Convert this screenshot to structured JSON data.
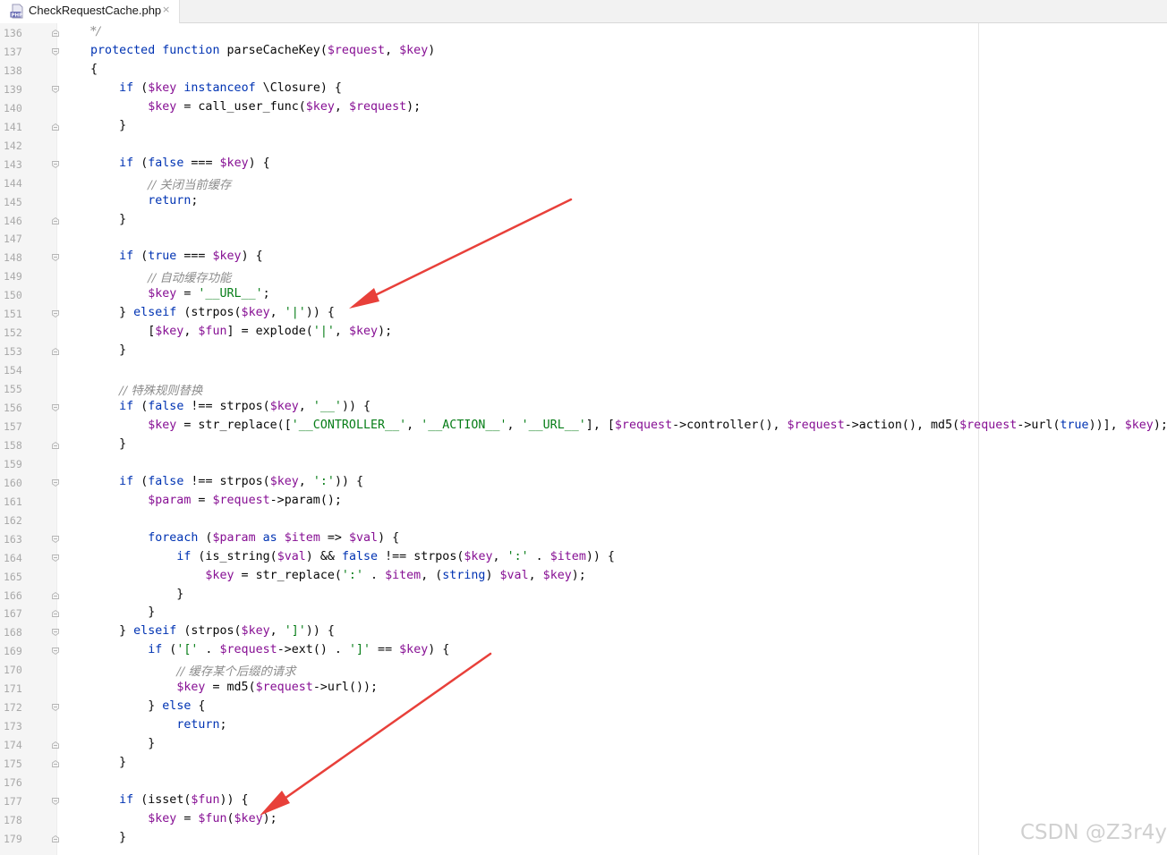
{
  "tab": {
    "file_icon": "php-file-icon",
    "title": "CheckRequestCache.php",
    "close_glyph": "×"
  },
  "editor": {
    "lines": [
      {
        "n": "136",
        "fold": "end",
        "tokens": [
          [
            "cm",
            "*/"
          ]
        ]
      },
      {
        "n": "137",
        "fold": "start",
        "tokens": [
          [
            "kw",
            "protected"
          ],
          [
            "t",
            " "
          ],
          [
            "kw",
            "function"
          ],
          [
            "t",
            " parseCacheKey("
          ],
          [
            "var",
            "$request"
          ],
          [
            "t",
            ", "
          ],
          [
            "var",
            "$key"
          ],
          [
            "t",
            ")"
          ]
        ]
      },
      {
        "n": "138",
        "fold": "",
        "tokens": [
          [
            "t",
            "{"
          ]
        ]
      },
      {
        "n": "139",
        "fold": "start",
        "tokens": [
          [
            "t",
            "    "
          ],
          [
            "kw",
            "if"
          ],
          [
            "t",
            " ("
          ],
          [
            "var",
            "$key"
          ],
          [
            "t",
            " "
          ],
          [
            "kw",
            "instanceof"
          ],
          [
            "t",
            " \\Closure) {"
          ]
        ]
      },
      {
        "n": "140",
        "fold": "",
        "tokens": [
          [
            "t",
            "        "
          ],
          [
            "var",
            "$key"
          ],
          [
            "t",
            " = call_user_func("
          ],
          [
            "var",
            "$key"
          ],
          [
            "t",
            ", "
          ],
          [
            "var",
            "$request"
          ],
          [
            "t",
            ");"
          ]
        ]
      },
      {
        "n": "141",
        "fold": "end",
        "tokens": [
          [
            "t",
            "    }"
          ]
        ]
      },
      {
        "n": "142",
        "fold": "",
        "tokens": []
      },
      {
        "n": "143",
        "fold": "start",
        "tokens": [
          [
            "t",
            "    "
          ],
          [
            "kw",
            "if"
          ],
          [
            "t",
            " ("
          ],
          [
            "kw",
            "false"
          ],
          [
            "t",
            " === "
          ],
          [
            "var",
            "$key"
          ],
          [
            "t",
            ") {"
          ]
        ]
      },
      {
        "n": "144",
        "fold": "",
        "tokens": [
          [
            "t",
            "        "
          ],
          [
            "cm",
            "// 关闭当前缓存"
          ]
        ]
      },
      {
        "n": "145",
        "fold": "",
        "tokens": [
          [
            "t",
            "        "
          ],
          [
            "kw",
            "return"
          ],
          [
            "t",
            ";"
          ]
        ]
      },
      {
        "n": "146",
        "fold": "end",
        "tokens": [
          [
            "t",
            "    }"
          ]
        ]
      },
      {
        "n": "147",
        "fold": "",
        "tokens": []
      },
      {
        "n": "148",
        "fold": "start",
        "tokens": [
          [
            "t",
            "    "
          ],
          [
            "kw",
            "if"
          ],
          [
            "t",
            " ("
          ],
          [
            "kw",
            "true"
          ],
          [
            "t",
            " === "
          ],
          [
            "var",
            "$key"
          ],
          [
            "t",
            ") {"
          ]
        ]
      },
      {
        "n": "149",
        "fold": "",
        "tokens": [
          [
            "t",
            "        "
          ],
          [
            "cm",
            "// 自动缓存功能"
          ]
        ]
      },
      {
        "n": "150",
        "fold": "",
        "tokens": [
          [
            "t",
            "        "
          ],
          [
            "var",
            "$key"
          ],
          [
            "t",
            " = "
          ],
          [
            "str",
            "'__URL__'"
          ],
          [
            "t",
            ";"
          ]
        ]
      },
      {
        "n": "151",
        "fold": "start",
        "tokens": [
          [
            "t",
            "    } "
          ],
          [
            "kw",
            "elseif"
          ],
          [
            "t",
            " (strpos("
          ],
          [
            "var",
            "$key"
          ],
          [
            "t",
            ", "
          ],
          [
            "str",
            "'|'"
          ],
          [
            "t",
            ")) {"
          ]
        ]
      },
      {
        "n": "152",
        "fold": "",
        "tokens": [
          [
            "t",
            "        ["
          ],
          [
            "var",
            "$key"
          ],
          [
            "t",
            ", "
          ],
          [
            "var",
            "$fun"
          ],
          [
            "t",
            "] = explode("
          ],
          [
            "str",
            "'|'"
          ],
          [
            "t",
            ", "
          ],
          [
            "var",
            "$key"
          ],
          [
            "t",
            ");"
          ]
        ]
      },
      {
        "n": "153",
        "fold": "end",
        "tokens": [
          [
            "t",
            "    }"
          ]
        ]
      },
      {
        "n": "154",
        "fold": "",
        "tokens": []
      },
      {
        "n": "155",
        "fold": "",
        "tokens": [
          [
            "t",
            "    "
          ],
          [
            "cm",
            "// 特殊规则替换"
          ]
        ]
      },
      {
        "n": "156",
        "fold": "start",
        "tokens": [
          [
            "t",
            "    "
          ],
          [
            "kw",
            "if"
          ],
          [
            "t",
            " ("
          ],
          [
            "kw",
            "false"
          ],
          [
            "t",
            " !== strpos("
          ],
          [
            "var",
            "$key"
          ],
          [
            "t",
            ", "
          ],
          [
            "str",
            "'__'"
          ],
          [
            "t",
            ")) {"
          ]
        ]
      },
      {
        "n": "157",
        "fold": "",
        "tokens": [
          [
            "t",
            "        "
          ],
          [
            "var",
            "$key"
          ],
          [
            "t",
            " = str_replace(["
          ],
          [
            "str",
            "'__CONTROLLER__'"
          ],
          [
            "t",
            ", "
          ],
          [
            "str",
            "'__ACTION__'"
          ],
          [
            "t",
            ", "
          ],
          [
            "str",
            "'__URL__'"
          ],
          [
            "t",
            "], ["
          ],
          [
            "var",
            "$request"
          ],
          [
            "t",
            "->controller(), "
          ],
          [
            "var",
            "$request"
          ],
          [
            "t",
            "->action(), md5("
          ],
          [
            "var",
            "$request"
          ],
          [
            "t",
            "->url("
          ],
          [
            "kw",
            "true"
          ],
          [
            "t",
            "))], "
          ],
          [
            "var",
            "$key"
          ],
          [
            "t",
            ");"
          ]
        ]
      },
      {
        "n": "158",
        "fold": "end",
        "tokens": [
          [
            "t",
            "    }"
          ]
        ]
      },
      {
        "n": "159",
        "fold": "",
        "tokens": []
      },
      {
        "n": "160",
        "fold": "start",
        "tokens": [
          [
            "t",
            "    "
          ],
          [
            "kw",
            "if"
          ],
          [
            "t",
            " ("
          ],
          [
            "kw",
            "false"
          ],
          [
            "t",
            " !== strpos("
          ],
          [
            "var",
            "$key"
          ],
          [
            "t",
            ", "
          ],
          [
            "str",
            "':'"
          ],
          [
            "t",
            ")) {"
          ]
        ]
      },
      {
        "n": "161",
        "fold": "",
        "tokens": [
          [
            "t",
            "        "
          ],
          [
            "var",
            "$param"
          ],
          [
            "t",
            " = "
          ],
          [
            "var",
            "$request"
          ],
          [
            "t",
            "->param();"
          ]
        ]
      },
      {
        "n": "162",
        "fold": "",
        "tokens": []
      },
      {
        "n": "163",
        "fold": "start",
        "tokens": [
          [
            "t",
            "        "
          ],
          [
            "kw",
            "foreach"
          ],
          [
            "t",
            " ("
          ],
          [
            "var",
            "$param"
          ],
          [
            "t",
            " "
          ],
          [
            "kw",
            "as"
          ],
          [
            "t",
            " "
          ],
          [
            "var",
            "$item"
          ],
          [
            "t",
            " => "
          ],
          [
            "var",
            "$val"
          ],
          [
            "t",
            ") {"
          ]
        ]
      },
      {
        "n": "164",
        "fold": "start",
        "tokens": [
          [
            "t",
            "            "
          ],
          [
            "kw",
            "if"
          ],
          [
            "t",
            " (is_string("
          ],
          [
            "var",
            "$val"
          ],
          [
            "t",
            ") && "
          ],
          [
            "kw",
            "false"
          ],
          [
            "t",
            " !== strpos("
          ],
          [
            "var",
            "$key"
          ],
          [
            "t",
            ", "
          ],
          [
            "str",
            "':'"
          ],
          [
            "t",
            " . "
          ],
          [
            "var",
            "$item"
          ],
          [
            "t",
            ")) {"
          ]
        ]
      },
      {
        "n": "165",
        "fold": "",
        "tokens": [
          [
            "t",
            "                "
          ],
          [
            "var",
            "$key"
          ],
          [
            "t",
            " = str_replace("
          ],
          [
            "str",
            "':'"
          ],
          [
            "t",
            " . "
          ],
          [
            "var",
            "$item"
          ],
          [
            "t",
            ", ("
          ],
          [
            "kw",
            "string"
          ],
          [
            "t",
            ") "
          ],
          [
            "var",
            "$val"
          ],
          [
            "t",
            ", "
          ],
          [
            "var",
            "$key"
          ],
          [
            "t",
            ");"
          ]
        ]
      },
      {
        "n": "166",
        "fold": "end",
        "tokens": [
          [
            "t",
            "            }"
          ]
        ]
      },
      {
        "n": "167",
        "fold": "end",
        "tokens": [
          [
            "t",
            "        }"
          ]
        ]
      },
      {
        "n": "168",
        "fold": "start",
        "tokens": [
          [
            "t",
            "    } "
          ],
          [
            "kw",
            "elseif"
          ],
          [
            "t",
            " (strpos("
          ],
          [
            "var",
            "$key"
          ],
          [
            "t",
            ", "
          ],
          [
            "str",
            "']'"
          ],
          [
            "t",
            ")) {"
          ]
        ]
      },
      {
        "n": "169",
        "fold": "start",
        "tokens": [
          [
            "t",
            "        "
          ],
          [
            "kw",
            "if"
          ],
          [
            "t",
            " ("
          ],
          [
            "str",
            "'['"
          ],
          [
            "t",
            " . "
          ],
          [
            "var",
            "$request"
          ],
          [
            "t",
            "->ext() . "
          ],
          [
            "str",
            "']'"
          ],
          [
            "t",
            " == "
          ],
          [
            "var",
            "$key"
          ],
          [
            "t",
            ") {"
          ]
        ]
      },
      {
        "n": "170",
        "fold": "",
        "tokens": [
          [
            "t",
            "            "
          ],
          [
            "cm",
            "// 缓存某个后缀的请求"
          ]
        ]
      },
      {
        "n": "171",
        "fold": "",
        "tokens": [
          [
            "t",
            "            "
          ],
          [
            "var",
            "$key"
          ],
          [
            "t",
            " = md5("
          ],
          [
            "var",
            "$request"
          ],
          [
            "t",
            "->url());"
          ]
        ]
      },
      {
        "n": "172",
        "fold": "start",
        "tokens": [
          [
            "t",
            "        } "
          ],
          [
            "kw",
            "else"
          ],
          [
            "t",
            " {"
          ]
        ]
      },
      {
        "n": "173",
        "fold": "",
        "tokens": [
          [
            "t",
            "            "
          ],
          [
            "kw",
            "return"
          ],
          [
            "t",
            ";"
          ]
        ]
      },
      {
        "n": "174",
        "fold": "end",
        "tokens": [
          [
            "t",
            "        }"
          ]
        ]
      },
      {
        "n": "175",
        "fold": "end",
        "tokens": [
          [
            "t",
            "    }"
          ]
        ]
      },
      {
        "n": "176",
        "fold": "",
        "tokens": []
      },
      {
        "n": "177",
        "fold": "start",
        "tokens": [
          [
            "t",
            "    "
          ],
          [
            "kw",
            "if"
          ],
          [
            "t",
            " (isset("
          ],
          [
            "var",
            "$fun"
          ],
          [
            "t",
            ")) {"
          ]
        ]
      },
      {
        "n": "178",
        "fold": "",
        "tokens": [
          [
            "t",
            "        "
          ],
          [
            "var",
            "$key"
          ],
          [
            "t",
            " = "
          ],
          [
            "var",
            "$fun"
          ],
          [
            "t",
            "("
          ],
          [
            "var",
            "$key"
          ],
          [
            "t",
            ");"
          ]
        ]
      },
      {
        "n": "179",
        "fold": "end",
        "tokens": [
          [
            "t",
            "    }"
          ]
        ]
      }
    ]
  },
  "annotations": {
    "arrow_color": "#e8403a",
    "arrows": [
      "arrow-to-explode-line",
      "arrow-to-fun-call-line"
    ]
  },
  "watermark": {
    "text": "CSDN @Z3r4y"
  },
  "colors": {
    "keyword": "#0033b3",
    "variable": "#871094",
    "string": "#067d17",
    "comment": "#8c8c8c",
    "text": "#080808",
    "line_number": "#a9a9a9"
  }
}
